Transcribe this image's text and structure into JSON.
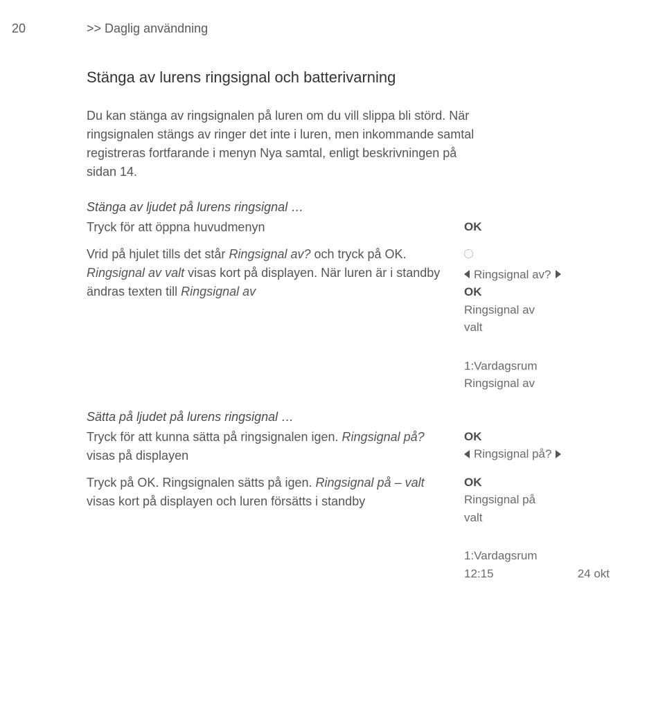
{
  "page_number": "20",
  "chapter": ">> Daglig användning",
  "heading": "Stänga av lurens ringsignal och batterivarning",
  "intro": "Du kan stänga av ringsignalen på luren om du vill slippa bli störd. När ringsignalen stängs av ringer det inte i luren, men inkommande samtal registreras fortfarande i menyn Nya samtal, enligt beskrivningen på sidan 14.",
  "section1": {
    "subhead": "Stänga av ljudet på lurens ringsignal …",
    "step1": "Tryck för att öppna huvudmenyn",
    "r1": "OK",
    "step2a": "Vrid på hjulet tills det står ",
    "step2b": "Ringsignal av?",
    "step2c": " och tryck på OK. ",
    "step2d": "Ringsignal av valt",
    "step2e": " visas kort på displayen. När luren är i standby ändras texten till ",
    "step2f": "Ringsignal av",
    "r2": "Ringsignal av?",
    "r3": "OK",
    "r4": "Ringsignal av",
    "r5": "valt"
  },
  "mid": {
    "line1": "1:Vardagsrum",
    "line2": "Ringsignal av"
  },
  "section2": {
    "subhead": "Sätta på ljudet på lurens ringsignal …",
    "step1": "Tryck för att kunna sätta på ringsignalen igen. ",
    "step1b": "Ringsignal på?",
    "step1c": " visas på displayen",
    "r1": "OK",
    "r2": "Ringsignal på?",
    "step2a": "Tryck på OK. Ringsignalen sätts på igen. ",
    "step2b": "Ringsignal på – valt",
    "step2c": " visas kort på displayen och luren försätts i standby",
    "r3": "OK",
    "r4": "Ringsignal på",
    "r5": "valt"
  },
  "bottom": {
    "line1": "1:Vardagsrum",
    "time": "12:15",
    "date": "24 okt"
  }
}
